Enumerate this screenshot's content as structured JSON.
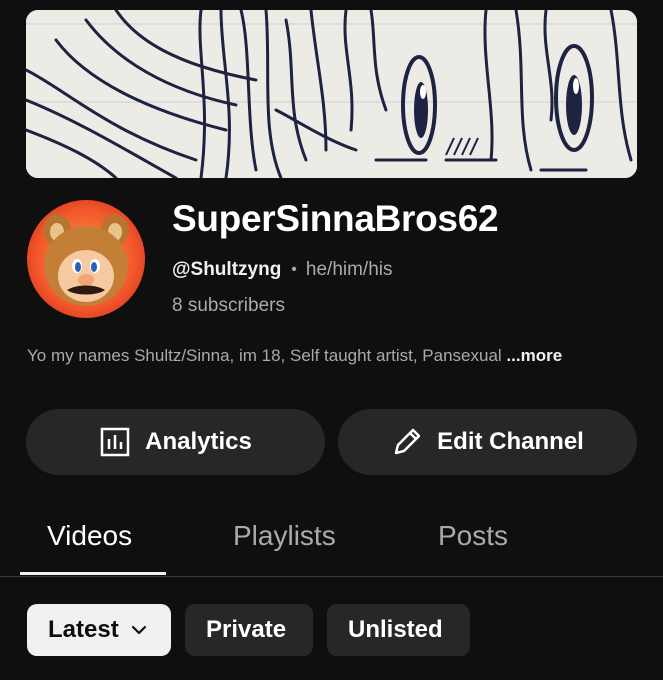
{
  "channel": {
    "name": "SuperSinnaBros62",
    "handle": "@Shultzyng",
    "separator": "•",
    "pronouns": "he/him/his",
    "subscribers": "8 subscribers",
    "description": "Yo my names Shultz/Sinna, im 18, Self taught artist, Pansexual",
    "more_label": "...more"
  },
  "actions": {
    "analytics_label": "Analytics",
    "edit_label": "Edit Channel"
  },
  "tabs": [
    {
      "label": "Videos",
      "active": true
    },
    {
      "label": "Playlists",
      "active": false
    },
    {
      "label": "Posts",
      "active": false
    }
  ],
  "filters": {
    "selected": "Latest",
    "chips": [
      "Private",
      "Unlisted"
    ]
  },
  "icons": {
    "analytics": "analytics-icon",
    "edit": "pencil-icon",
    "dropdown": "chevron-down-icon"
  },
  "colors": {
    "background": "#0f0f0f",
    "surface": "#272727",
    "text_primary": "#f1f1f1",
    "text_secondary": "#aaaaaa"
  }
}
